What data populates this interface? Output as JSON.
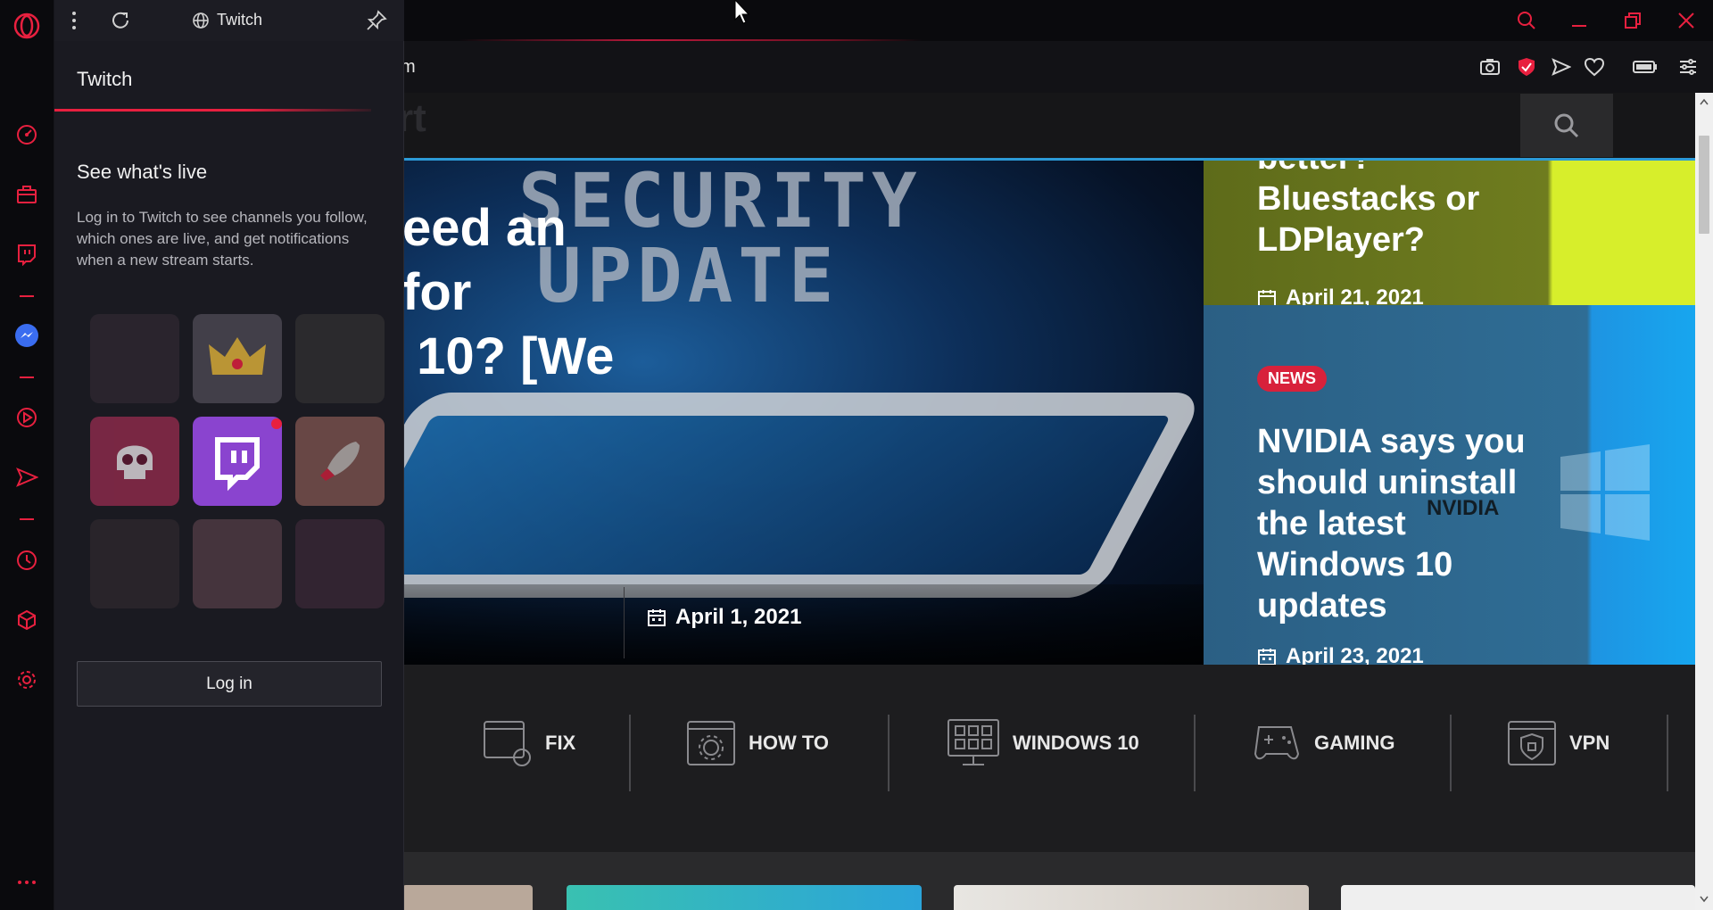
{
  "browser": {
    "address_partial": "m",
    "accent": "#e8203f"
  },
  "twitch_panel": {
    "header_title": "Twitch",
    "panel_title": "Twitch",
    "heading": "See what's live",
    "description": "Log in to Twitch to see channels you follow, which ones are live, and get notifications when a new stream starts.",
    "login_label": "Log in"
  },
  "site": {
    "header_ghost": "rt",
    "hero": {
      "title": "eed an\nfor\n 10? [We",
      "bg_text_1": "SECURITY",
      "bg_text_2": "UPDATE",
      "date": "April 1, 2021"
    },
    "card_top": {
      "title": "better?\nBluestacks or\nLDPlayer?",
      "date": "April 21, 2021"
    },
    "card_main": {
      "badge": "NEWS",
      "title": "NVIDIA says you\nshould uninstall\nthe latest\nWindows 10\nupdates",
      "logo_text": "NVIDIA",
      "date": "April 23, 2021"
    },
    "categories": [
      {
        "label": "FIX",
        "icon": "window-refresh-icon"
      },
      {
        "label": "HOW TO",
        "icon": "window-gear-icon"
      },
      {
        "label": "WINDOWS 10",
        "icon": "monitor-grid-icon"
      },
      {
        "label": "GAMING",
        "icon": "gamepad-icon"
      },
      {
        "label": "VPN",
        "icon": "window-shield-icon"
      }
    ]
  }
}
